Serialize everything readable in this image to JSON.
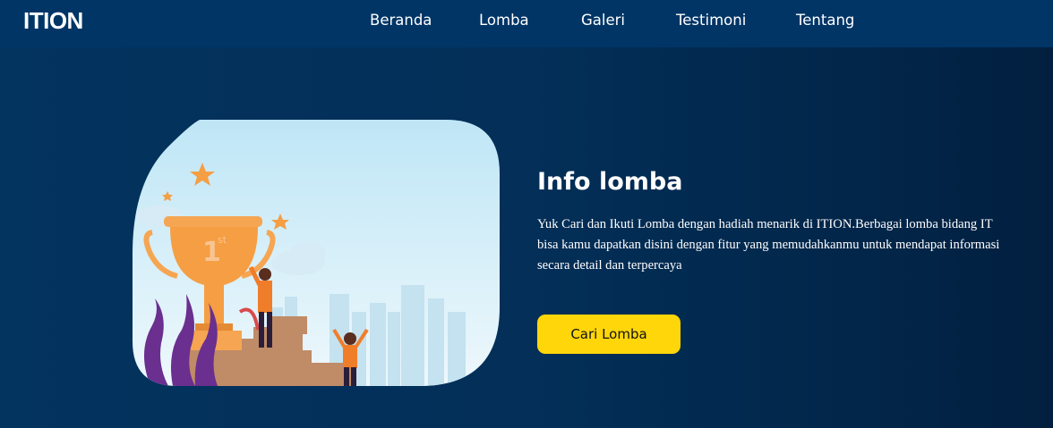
{
  "navbar": {
    "logo": "ITION",
    "items": [
      {
        "label": "Beranda"
      },
      {
        "label": "Lomba"
      },
      {
        "label": "Galeri"
      },
      {
        "label": "Testimoni"
      },
      {
        "label": "Tentang"
      }
    ]
  },
  "hero": {
    "trophy_label": "1",
    "trophy_sup": "st",
    "title": "Info lomba",
    "description": "Yuk Cari dan Ikuti Lomba dengan hadiah menarik di ITION.Berbagai lomba bidang IT bisa kamu dapatkan disini dengan fitur yang memudahkanmu untuk mendapat informasi secara detail dan terpercaya",
    "button_label": "Cari Lomba"
  },
  "colors": {
    "navbar_bg": "#003566",
    "page_bg": "#03335f",
    "accent_button": "#ffd60a",
    "trophy": "#f6a552"
  }
}
